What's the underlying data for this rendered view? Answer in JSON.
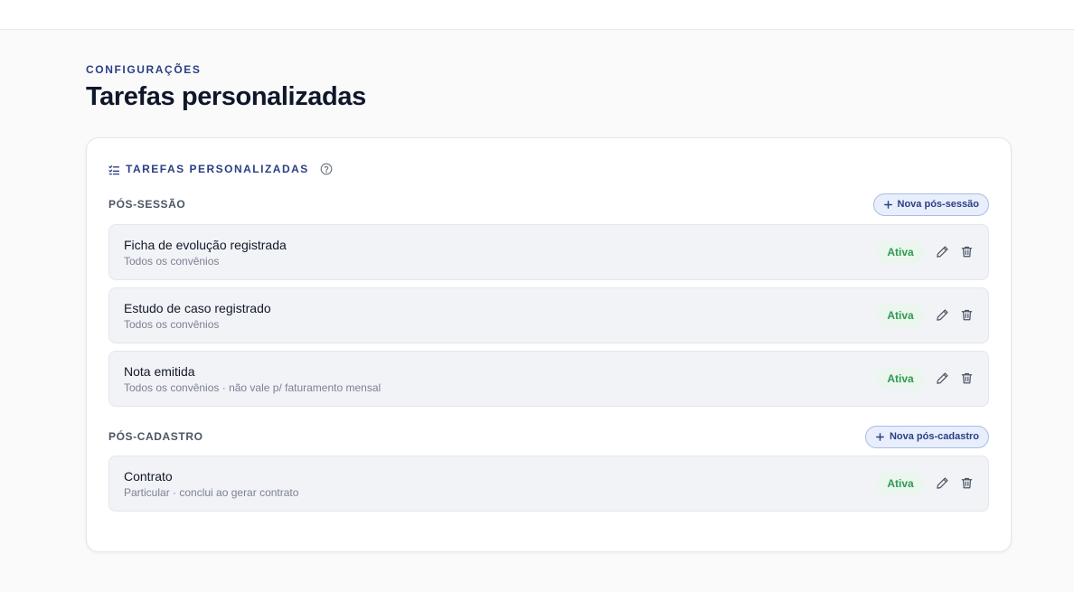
{
  "header": {
    "eyebrow": "CONFIGURAÇÕES",
    "title": "Tarefas personalizadas"
  },
  "card": {
    "title": "TAREFAS PERSONALIZADAS",
    "title_icon": "list-check-icon",
    "help_icon": "help-circle-icon"
  },
  "sections": [
    {
      "label": "PÓS-SESSÃO",
      "new_button": "Nova pós-sessão",
      "tasks": [
        {
          "name": "Ficha de evolução registrada",
          "subtitle": "Todos os convênios",
          "status": "Ativa"
        },
        {
          "name": "Estudo de caso registrado",
          "subtitle": "Todos os convênios",
          "status": "Ativa"
        },
        {
          "name": "Nota emitida",
          "subtitle": "Todos os convênios · não vale p/ faturamento mensal",
          "status": "Ativa"
        }
      ]
    },
    {
      "label": "PÓS-CADASTRO",
      "new_button": "Nova pós-cadastro",
      "tasks": [
        {
          "name": "Contrato",
          "subtitle": "Particular · conclui ao gerar contrato",
          "status": "Ativa"
        }
      ]
    }
  ],
  "icons": {
    "edit": "pencil-icon",
    "delete": "trash-icon",
    "add": "plus-icon"
  },
  "colors": {
    "accent": "#2b3f86",
    "status_text": "#2f9a51",
    "status_bg": "#eaf6ee",
    "row_bg": "#f1f3f7",
    "button_bg": "#e8eefb"
  }
}
